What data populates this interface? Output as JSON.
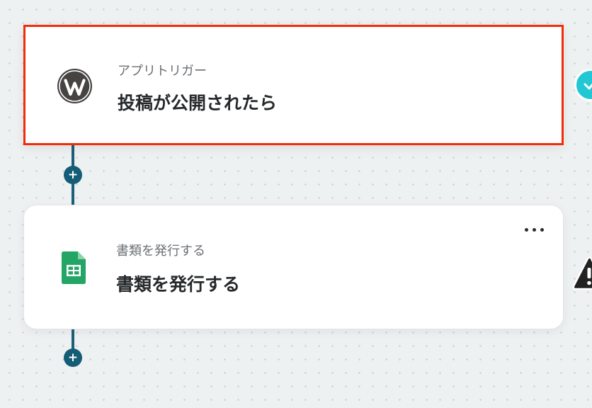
{
  "colors": {
    "trigger_border": "#f12c09",
    "connector": "#1d5f78",
    "check_badge": "#21c8d4",
    "sheets_green": "#23a565"
  },
  "trigger_card": {
    "icon": "wordpress-icon",
    "sub_label": "アプリトリガー",
    "title": "投稿が公開されたら",
    "status_icon": "check-icon"
  },
  "add_step_buttons": [
    {
      "label": "+"
    },
    {
      "label": "+"
    }
  ],
  "action_card": {
    "icon": "google-sheets-icon",
    "sub_label": "書類を発行する",
    "title": "書類を発行する",
    "menu_icon": "more-dots-icon",
    "status_icon": "warning-icon"
  }
}
